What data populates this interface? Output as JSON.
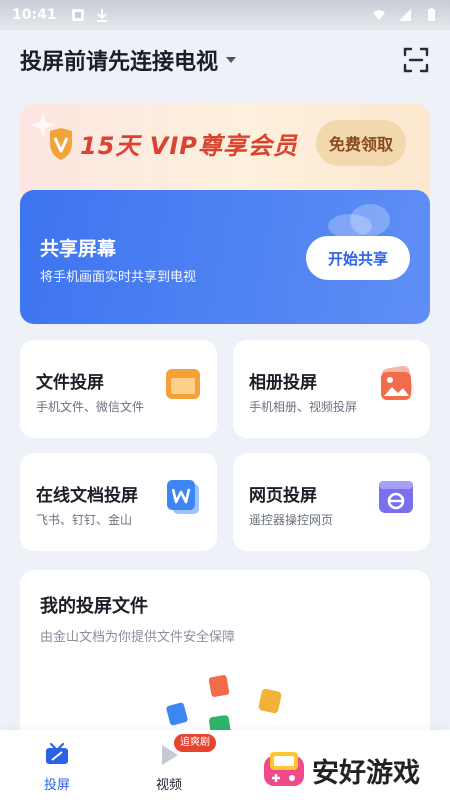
{
  "status_bar": {
    "time": "10:41",
    "icons": [
      "notification-icon",
      "download-icon",
      "wifi-icon",
      "signal-icon",
      "battery-icon"
    ]
  },
  "header": {
    "title": "投屏前请先连接电视",
    "scan_icon": "scan-icon"
  },
  "vip_banner": {
    "text": "15天 VIP尊享会员",
    "claim_label": "免费领取",
    "accent": "#d9432f"
  },
  "share": {
    "title": "共享屏幕",
    "subtitle": "将手机画面实时共享到电视",
    "button_label": "开始共享",
    "color": "#3d74f0"
  },
  "tiles": [
    {
      "title": "文件投屏",
      "subtitle": "手机文件、微信文件",
      "icon": "folder-icon"
    },
    {
      "title": "相册投屏",
      "subtitle": "手机相册、视频投屏",
      "icon": "photo-icon"
    },
    {
      "title": "在线文档投屏",
      "subtitle": "飞书、钉钉、金山",
      "icon": "document-w-icon"
    },
    {
      "title": "网页投屏",
      "subtitle": "遥控器操控网页",
      "icon": "browser-icon"
    }
  ],
  "files": {
    "title": "我的投屏文件",
    "subtitle": "由金山文档为你提供文件安全保障"
  },
  "bottom_nav": {
    "items": [
      {
        "label": "投屏",
        "icon": "cast-icon",
        "active": true
      },
      {
        "label": "视频",
        "icon": "play-icon",
        "badge": "追爽剧"
      }
    ]
  },
  "watermark": {
    "text": "安好游戏"
  }
}
